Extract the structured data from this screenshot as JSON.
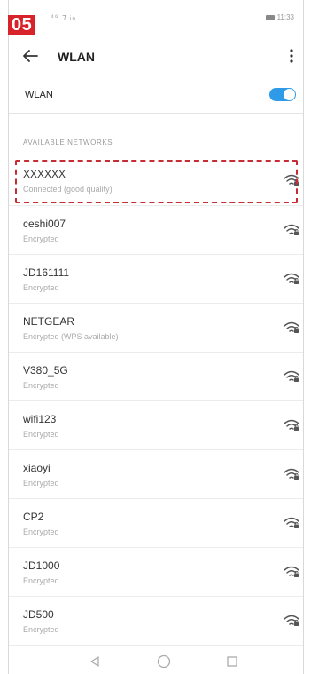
{
  "step_badge": "05",
  "status_bar": {
    "left": "⁴⁶ ⁊ ᵢₒ",
    "time": "11:33"
  },
  "app_bar": {
    "title": "WLAN"
  },
  "wlan": {
    "label": "WLAN",
    "enabled": true
  },
  "section": {
    "title": "AVAILABLE NETWORKS"
  },
  "networks": [
    {
      "name": "XXXXXX",
      "status": "Connected (good quality)"
    },
    {
      "name": "ceshi007",
      "status": "Encrypted"
    },
    {
      "name": "JD161111",
      "status": "Encrypted"
    },
    {
      "name": "NETGEAR",
      "status": "Encrypted (WPS available)"
    },
    {
      "name": "V380_5G",
      "status": "Encrypted"
    },
    {
      "name": "wifi123",
      "status": "Encrypted"
    },
    {
      "name": "xiaoyi",
      "status": "Encrypted"
    },
    {
      "name": "CP2",
      "status": "Encrypted"
    },
    {
      "name": "JD1000",
      "status": "Encrypted"
    },
    {
      "name": "JD500",
      "status": "Encrypted"
    }
  ],
  "colors": {
    "accent": "#2f9be8",
    "badge": "#d8232a",
    "highlight": "#c62c33"
  },
  "icons": [
    "back-arrow-icon",
    "more-vert-icon",
    "wifi-lock-icon",
    "nav-back-icon",
    "nav-home-icon",
    "nav-recent-icon"
  ]
}
